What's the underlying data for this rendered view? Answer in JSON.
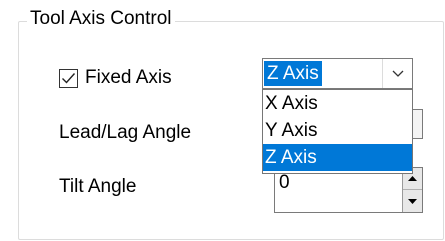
{
  "group": {
    "title": "Tool Axis Control"
  },
  "fixed_axis": {
    "label": "Fixed Axis",
    "checked": true
  },
  "axis_combo": {
    "value": "Z Axis",
    "options": [
      "X Axis",
      "Y Axis",
      "Z Axis"
    ],
    "selected_index": 2
  },
  "lead_lag": {
    "label": "Lead/Lag Angle"
  },
  "tilt": {
    "label": "Tilt Angle",
    "value": "0"
  },
  "icons": {
    "checkbox": "checkmark-icon",
    "combo_arrow": "chevron-down-icon",
    "spin_up": "triangle-up-icon",
    "spin_down": "triangle-down-icon"
  },
  "colors": {
    "selection": "#0078d7",
    "selection_text": "#ffffff",
    "border": "#7a7a7a",
    "group_border": "#dcdcdc"
  }
}
